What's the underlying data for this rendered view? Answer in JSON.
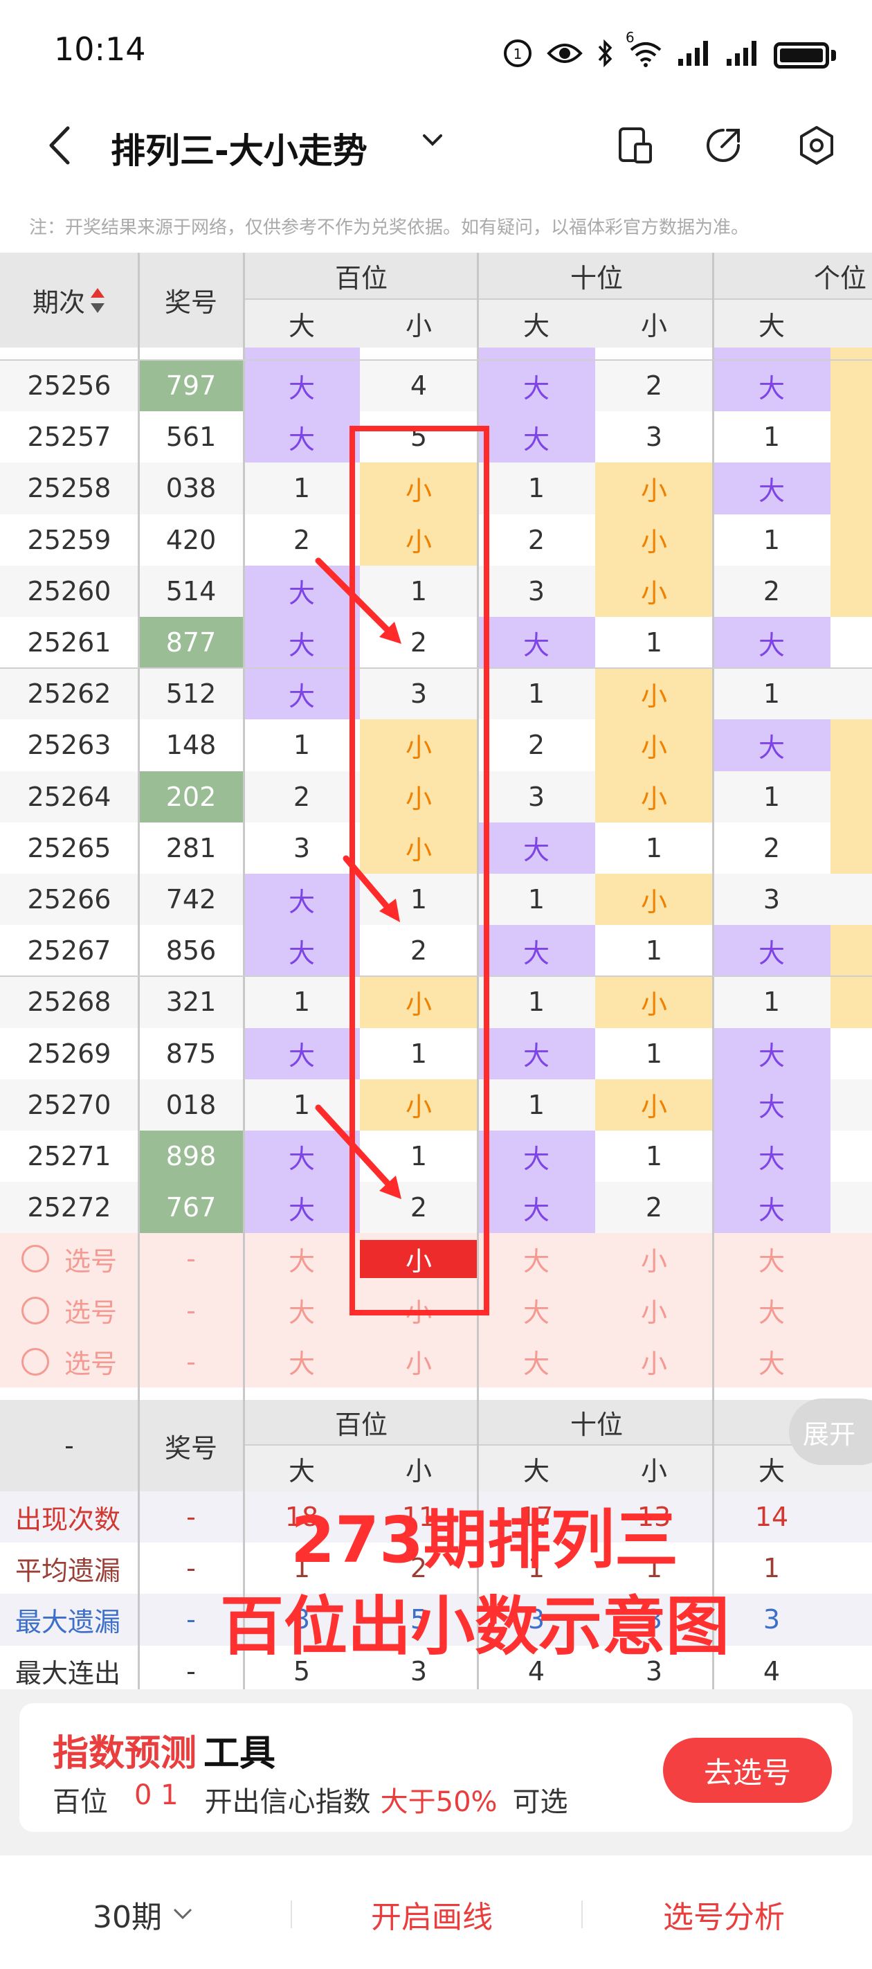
{
  "status_bar": {
    "time": "10:14",
    "signal_label": "6"
  },
  "header": {
    "title": "排列三-大小走势"
  },
  "notice": "注：开奖结果来源于网络，仅供参考不作为兑奖依据。如有疑问，以福体彩官方数据为准。",
  "table": {
    "col_issue": "期次",
    "col_number": "奖号",
    "groups": [
      "百位",
      "十位",
      "个位"
    ],
    "sub_big": "大",
    "sub_small": "小",
    "rows": [
      {
        "issue": "25256",
        "number": "797",
        "hl": true,
        "c": [
          "大",
          "4",
          "大",
          "2",
          "大"
        ]
      },
      {
        "issue": "25257",
        "number": "561",
        "hl": false,
        "c": [
          "大",
          "5",
          "大",
          "3",
          "1"
        ]
      },
      {
        "issue": "25258",
        "number": "038",
        "hl": false,
        "c": [
          "1",
          "小",
          "1",
          "小",
          "大"
        ]
      },
      {
        "issue": "25259",
        "number": "420",
        "hl": false,
        "c": [
          "2",
          "小",
          "2",
          "小",
          "1"
        ]
      },
      {
        "issue": "25260",
        "number": "514",
        "hl": false,
        "c": [
          "大",
          "1",
          "3",
          "小",
          "2"
        ]
      },
      {
        "issue": "25261",
        "number": "877",
        "hl": true,
        "c": [
          "大",
          "2",
          "大",
          "1",
          "大"
        ]
      },
      {
        "issue": "25262",
        "number": "512",
        "hl": false,
        "c": [
          "大",
          "3",
          "1",
          "小",
          "1"
        ]
      },
      {
        "issue": "25263",
        "number": "148",
        "hl": false,
        "c": [
          "1",
          "小",
          "2",
          "小",
          "大"
        ]
      },
      {
        "issue": "25264",
        "number": "202",
        "hl": true,
        "c": [
          "2",
          "小",
          "3",
          "小",
          "1"
        ]
      },
      {
        "issue": "25265",
        "number": "281",
        "hl": false,
        "c": [
          "3",
          "小",
          "大",
          "1",
          "2"
        ]
      },
      {
        "issue": "25266",
        "number": "742",
        "hl": false,
        "c": [
          "大",
          "1",
          "1",
          "小",
          "3"
        ]
      },
      {
        "issue": "25267",
        "number": "856",
        "hl": false,
        "c": [
          "大",
          "2",
          "大",
          "1",
          "大"
        ]
      },
      {
        "issue": "25268",
        "number": "321",
        "hl": false,
        "c": [
          "1",
          "小",
          "1",
          "小",
          "1"
        ]
      },
      {
        "issue": "25269",
        "number": "875",
        "hl": false,
        "c": [
          "大",
          "1",
          "大",
          "1",
          "大"
        ]
      },
      {
        "issue": "25270",
        "number": "018",
        "hl": false,
        "c": [
          "1",
          "小",
          "1",
          "小",
          "大"
        ]
      },
      {
        "issue": "25271",
        "number": "898",
        "hl": true,
        "c": [
          "大",
          "1",
          "大",
          "1",
          "大"
        ]
      },
      {
        "issue": "25272",
        "number": "767",
        "hl": true,
        "c": [
          "大",
          "2",
          "大",
          "2",
          "大"
        ]
      }
    ],
    "select_rows": [
      {
        "label": "选号",
        "number": "-",
        "c": [
          "大",
          "小",
          "大",
          "小",
          "大"
        ],
        "hundreds_small_selected": true
      },
      {
        "label": "选号",
        "number": "-",
        "c": [
          "大",
          "小",
          "大",
          "小",
          "大"
        ],
        "hundreds_small_selected": false
      },
      {
        "label": "选号",
        "number": "-",
        "c": [
          "大",
          "小",
          "大",
          "小",
          "大"
        ],
        "hundreds_small_selected": false
      }
    ]
  },
  "stats": {
    "label_dash": "-",
    "col_number": "奖号",
    "groups": [
      "百位",
      "十位",
      "个位"
    ],
    "expand_label": "展开",
    "rows": [
      {
        "label": "出现次数",
        "number": "-",
        "color": "#d2382f",
        "c": [
          "18",
          "11",
          "17",
          "13",
          "14"
        ]
      },
      {
        "label": "平均遗漏",
        "number": "-",
        "color": "#9b3e36",
        "c": [
          "1",
          "2",
          "1",
          "1",
          "1"
        ]
      },
      {
        "label": "最大遗漏",
        "number": "-",
        "color": "#3b6fc9",
        "c": [
          "3",
          "5",
          "3",
          "3",
          "3"
        ]
      },
      {
        "label": "最大连出",
        "number": "-",
        "color": "#333333",
        "c": [
          "5",
          "3",
          "4",
          "3",
          "4"
        ]
      }
    ]
  },
  "overlay": {
    "line1": "273期排列三",
    "line2": "百位出小数示意图"
  },
  "prediction": {
    "title_red": "指数预测",
    "title_black": "工具",
    "position": "百位",
    "digits": "0 1",
    "text": "开出信心指数",
    "threshold": "大于50%",
    "suffix": "可选",
    "button": "去选号"
  },
  "bottom_bar": {
    "period": "30期",
    "draw_line": "开启画线",
    "analysis": "选号分析"
  },
  "colors": {
    "big_bg": "#d9c6fb",
    "small_bg": "#fde4a9",
    "accent": "#f44040",
    "highlight_number": "#9bbd96"
  }
}
